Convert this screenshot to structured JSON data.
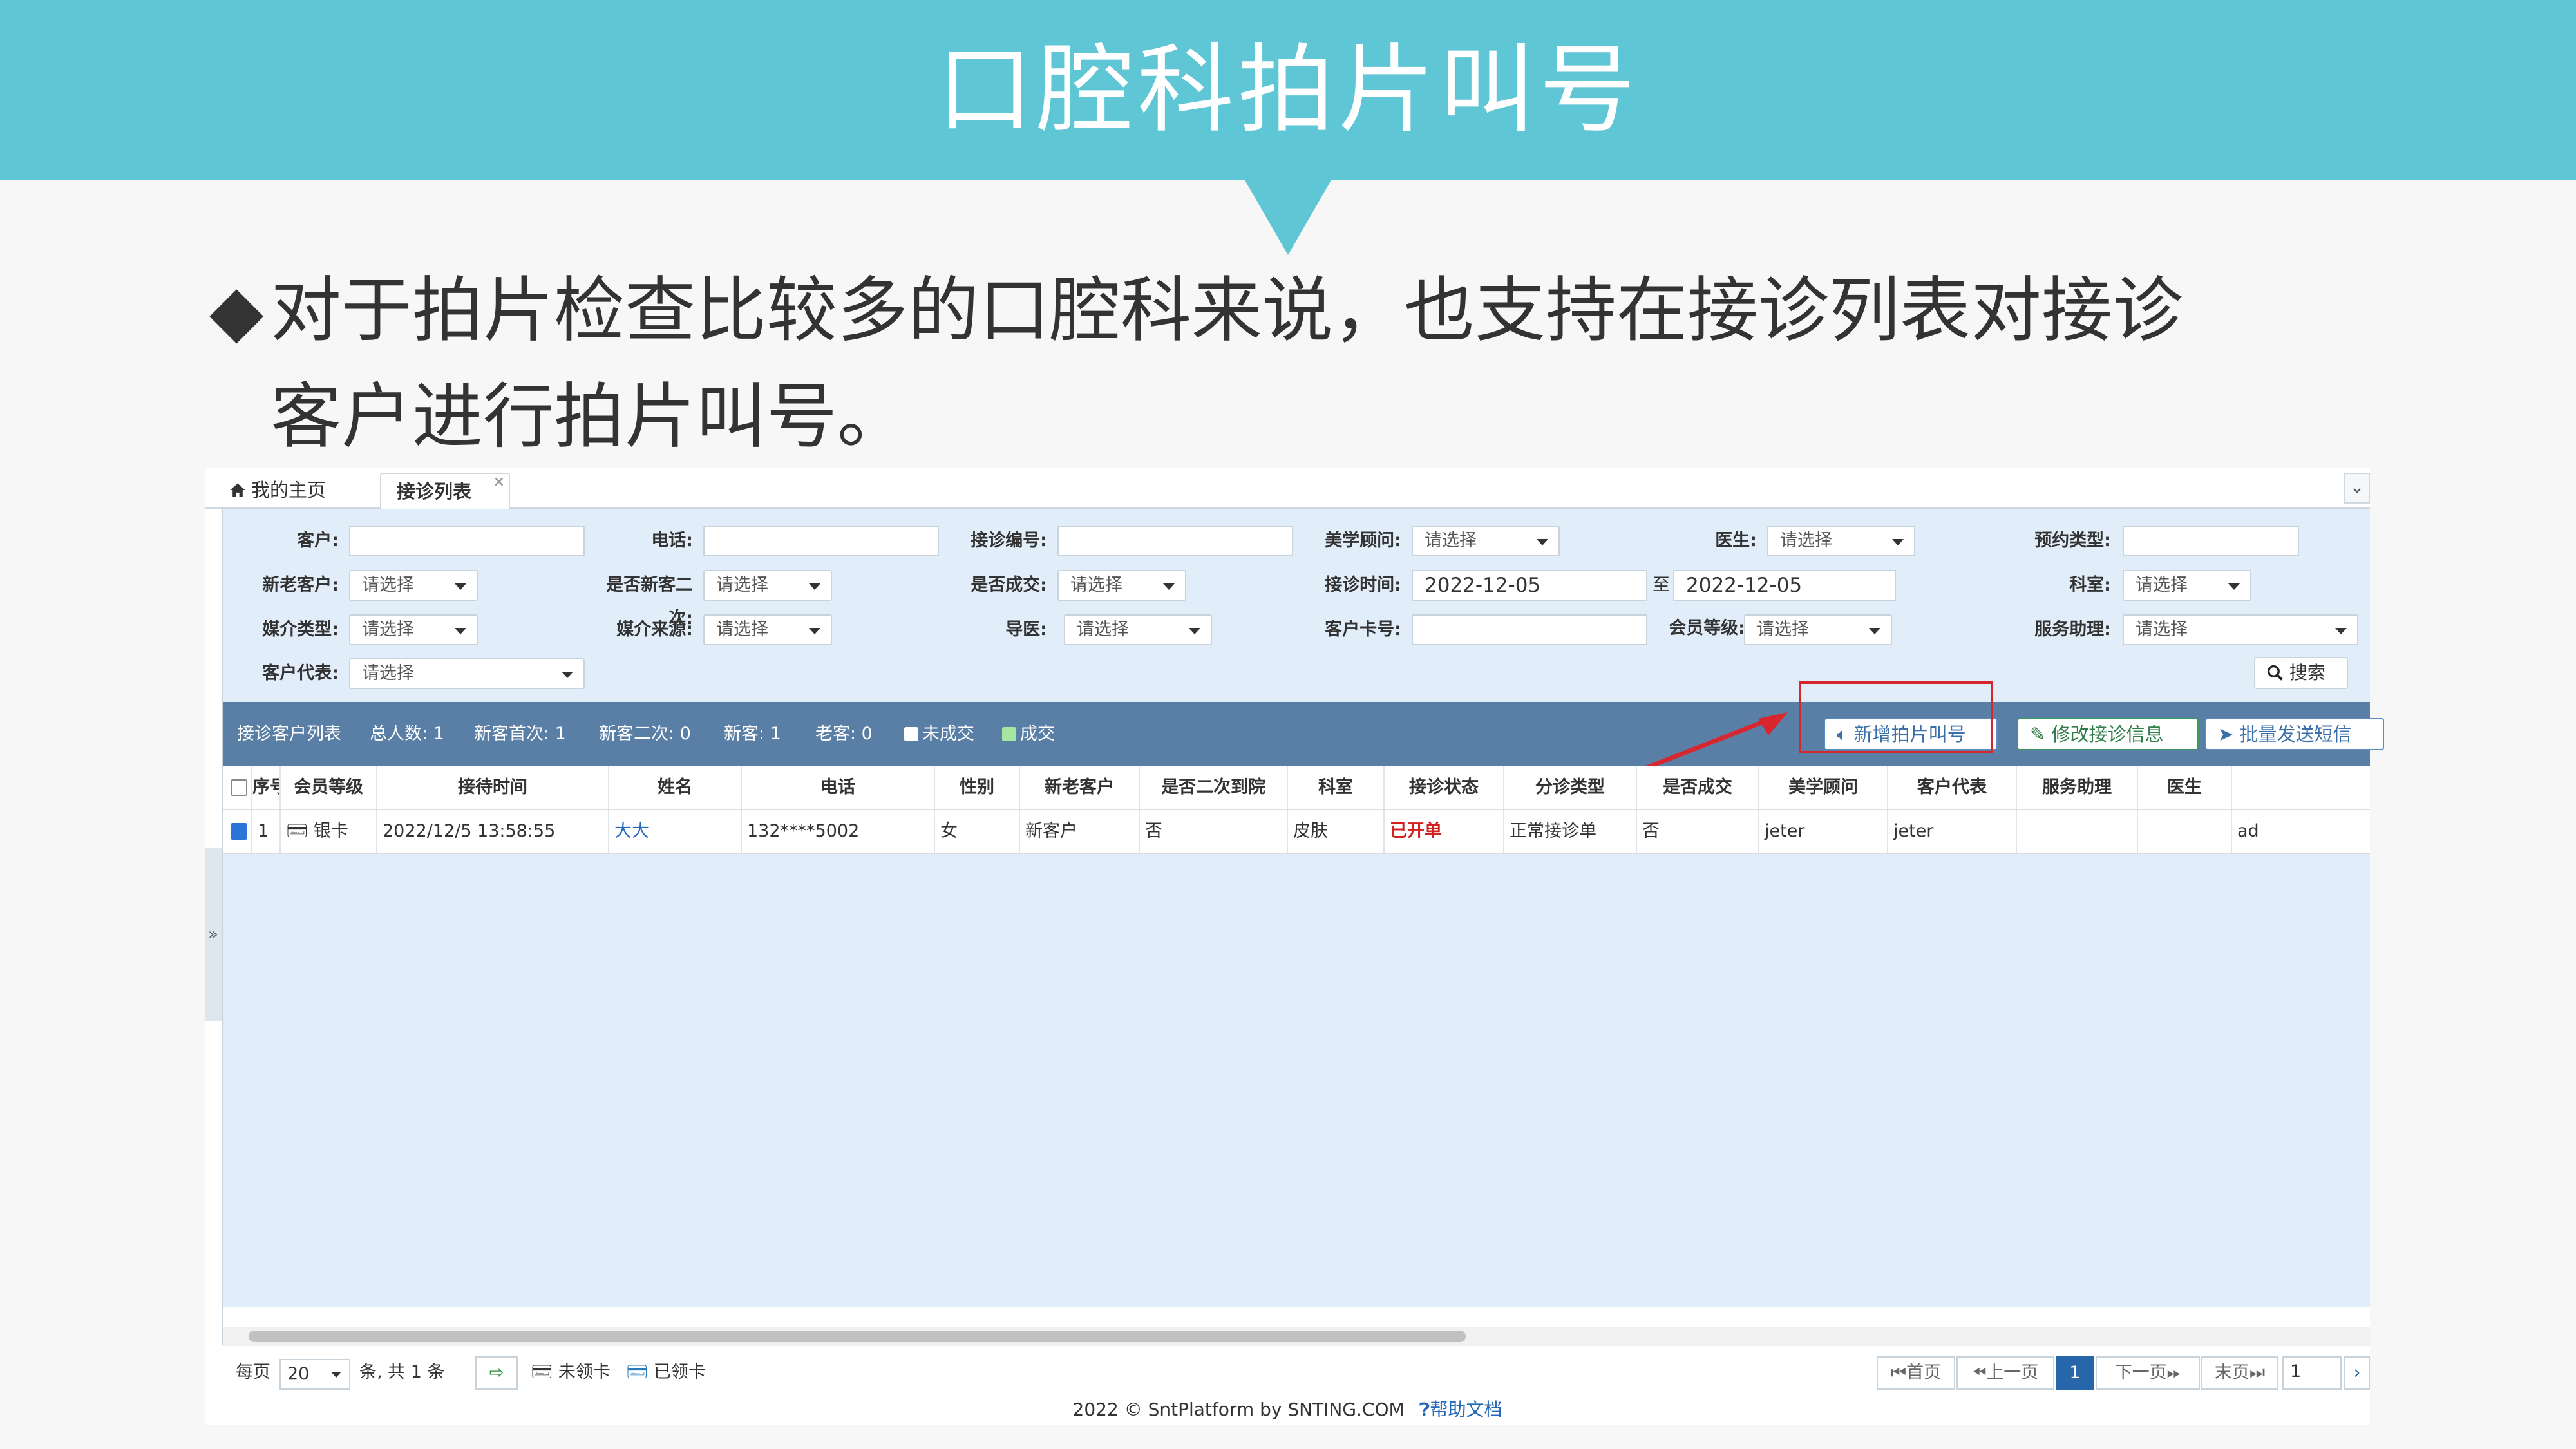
{
  "slide": {
    "title": "口腔科拍片叫号",
    "bullet_mark": "◆",
    "bullet_line1": "对于拍片检查比较多的口腔科来说，也支持在接诊列表对接诊",
    "bullet_line2": "客户进行拍片叫号。"
  },
  "tabs": {
    "home": "我的主页",
    "active": "接诊列表",
    "close": "×"
  },
  "filters": {
    "customer": "客户:",
    "phone": "电话:",
    "visit_no": "接诊编号:",
    "consultant": "美学顾问:",
    "doctor": "医生:",
    "appt_type": "预约类型:",
    "new_old": "新老客户:",
    "second": "是否新客二次:",
    "deal": "是否成交:",
    "visit_time": "接诊时间:",
    "dept": "科室:",
    "media_type": "媒介类型:",
    "media_source": "媒介来源:",
    "guide": "导医:",
    "card_no": "客户卡号:",
    "member_level": "会员等级:",
    "assistant": "服务助理:",
    "rep": "客户代表:",
    "placeholder": "请选择",
    "date_from": "2022-12-05",
    "date_to": "2022-12-05",
    "to": "至",
    "search": "搜索"
  },
  "toolbar": {
    "list": "接诊客户列表",
    "total": "总人数: 1",
    "first": "新客首次: 1",
    "second": "新客二次: 0",
    "new": "新客: 1",
    "old": "老客: 0",
    "no_deal": "未成交",
    "deal": "成交",
    "btn_xray": "新增拍片叫号",
    "btn_edit": "修改接诊信息",
    "btn_sms": "批量发送短信"
  },
  "grid": {
    "headers": [
      "序号",
      "会员等级",
      "接待时间",
      "姓名",
      "电话",
      "性别",
      "新老客户",
      "是否二次到院",
      "科室",
      "接诊状态",
      "分诊类型",
      "是否成交",
      "美学顾问",
      "客户代表",
      "服务助理",
      "医生"
    ],
    "row": [
      "1",
      "银卡",
      "2022/12/5 13:58:55",
      "大大",
      "132****5002",
      "女",
      "新客户",
      "否",
      "皮肤",
      "已开单",
      "正常接诊单",
      "否",
      "jeter",
      "jeter",
      "",
      "",
      "ad"
    ]
  },
  "pager": {
    "per_page": "每页",
    "size": "20",
    "count": "条, 共 1 条",
    "unclaimed": "未领卡",
    "claimed": "已领卡",
    "first": "首页",
    "prev": "上一页",
    "page": "1",
    "next": "下一页",
    "last": "末页",
    "goto": "1"
  },
  "footer": {
    "copyright": "2022 © SntPlatform by SNTING.COM",
    "help": "帮助文档"
  },
  "colors": {
    "banner": "#5ec6d5",
    "toolbar": "#5a7fa6",
    "filter_bg": "#e1eef9",
    "highlight": "#d8262f"
  }
}
